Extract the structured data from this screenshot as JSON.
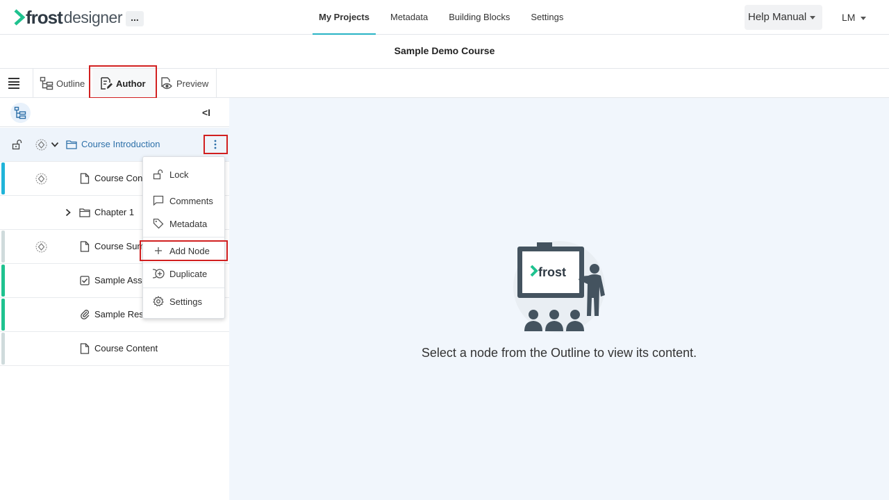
{
  "app": {
    "logo_frost": "frost",
    "logo_designer": "designer",
    "more_label": "...",
    "nav": [
      "My Projects",
      "Metadata",
      "Building Blocks",
      "Settings"
    ],
    "help_label": "Help Manual",
    "user_initials": "LM",
    "accent_color": "#27b3c5",
    "logo_green": "#1fc28f"
  },
  "course": {
    "title": "Sample Demo Course"
  },
  "view_tabs": {
    "outline": "Outline",
    "author": "Author",
    "preview": "Preview",
    "active": "Author"
  },
  "panel": {
    "collapse_label": "<I"
  },
  "outline": {
    "items": [
      {
        "label": "Course Introduction",
        "icon": "folder-icon",
        "selected": true,
        "status_color": ""
      },
      {
        "label": "Course Cont",
        "icon": "page-icon",
        "status_color": "#20b4d9"
      },
      {
        "label": "Chapter 1",
        "icon": "folder-icon",
        "status_color": ""
      },
      {
        "label": "Course Sum",
        "icon": "page-icon",
        "status_color": "#cfdbdc"
      },
      {
        "label": "Sample Asse",
        "icon": "checkbox-icon",
        "status_color": "#1fc28f"
      },
      {
        "label": "Sample Reso",
        "icon": "paperclip-icon",
        "status_color": "#1fc28f"
      },
      {
        "label": "Course Content",
        "icon": "page-icon",
        "status_color": "#cfdbdc"
      }
    ]
  },
  "context_menu": {
    "items": [
      {
        "label": "Lock",
        "icon": "lock-icon"
      },
      {
        "label": "Comments",
        "icon": "comment-icon"
      },
      {
        "label": "Metadata",
        "icon": "tag-icon"
      },
      {
        "label": "Add Node",
        "icon": "plus-icon",
        "highlighted": true
      },
      {
        "label": "Duplicate",
        "icon": "duplicate-icon"
      },
      {
        "label": "Settings",
        "icon": "gear-icon"
      }
    ]
  },
  "main": {
    "illustration_text": "frost",
    "empty_message": "Select a node from the Outline to view its content."
  }
}
